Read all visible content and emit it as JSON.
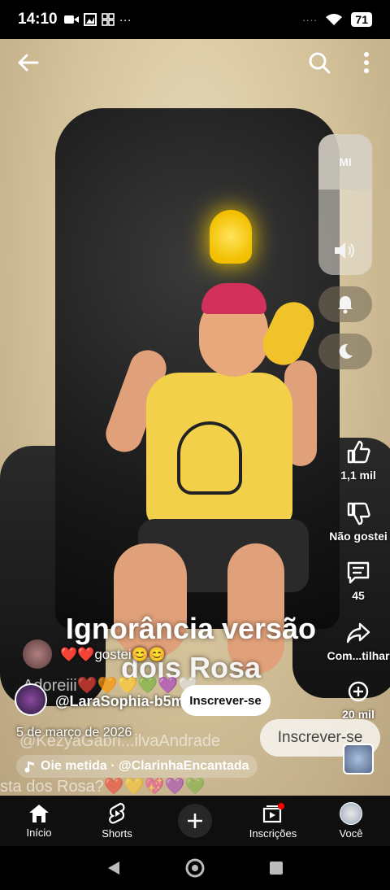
{
  "status_bar": {
    "time": "14:10",
    "left_icons": [
      "video-icon",
      "photo-icon",
      "grid-icon"
    ],
    "dots": "···",
    "signal_dots": "····",
    "battery": "71"
  },
  "video": {
    "title_line1": "Ignorância versão",
    "title_line2": "dois Rosa"
  },
  "system_panel": {
    "brand": "MI"
  },
  "actions": {
    "like_count": "1,1 mil",
    "dislike_label": "Não gostei",
    "comments_count": "45",
    "share_label": "Com...tilhar",
    "remix_count": "20 mil"
  },
  "comments": {
    "top_comment": "❤️❤️gostei😊😊",
    "faded_comment": "Adoreiii❤️🧡💛💚💜🤍",
    "faded_mention": "@KezyaGabri...ilvaAndrade",
    "bottom_faded": "sta dos Rosa?❤️💛💖💜💚"
  },
  "channel": {
    "handle": "@LaraSophia-b5m",
    "subscribe_label": "Inscrever-se",
    "subscribe_ghost_label": "Inscrever-se",
    "date": "5 de março de 2026",
    "sound": "Oie metida · @ClarinhaEncantada"
  },
  "nav": {
    "home": "Início",
    "shorts": "Shorts",
    "subscriptions": "Inscrições",
    "you": "Você"
  },
  "colors": {
    "accent_red": "#ff0000",
    "nav_bg": "#0f0f0f"
  }
}
